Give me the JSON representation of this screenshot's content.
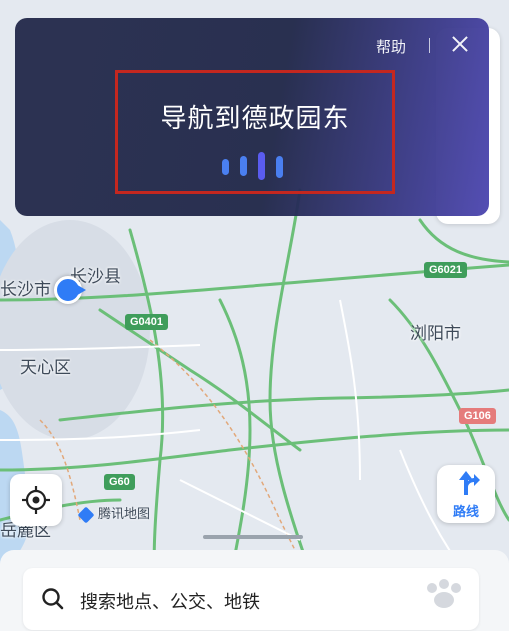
{
  "voice_assistant": {
    "help_label": "帮助",
    "recognized_text": "导航到德政园东"
  },
  "map": {
    "labels": {
      "changsha_city": "长沙市",
      "changsha_county": "长沙县",
      "tianxin_district": "天心区",
      "liuyang_city": "浏阳市",
      "yuelu_district": "岳麓区"
    },
    "road_badges": {
      "g0401": "G0401",
      "g6021": "G6021",
      "g106": "G106",
      "g60": "G60"
    },
    "map_brand": "腾讯地图"
  },
  "controls": {
    "route_label": "路线"
  },
  "search": {
    "placeholder": "搜索地点、公交、地铁"
  },
  "colors": {
    "accent": "#2f7cf6",
    "highway": "#3f9d5b",
    "overlay_bg": "#23294a",
    "highlight": "#c4271f"
  }
}
